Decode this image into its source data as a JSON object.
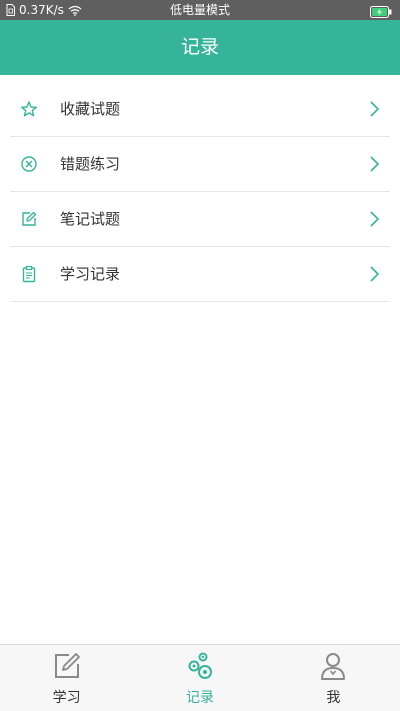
{
  "status_bar": {
    "network_speed": "0.37K/s",
    "center_text": "低电量模式",
    "icons": [
      "sim-icon",
      "wifi-icon",
      "battery-charging-icon"
    ]
  },
  "header": {
    "title": "记录"
  },
  "menu": {
    "items": [
      {
        "label": "收藏试题",
        "icon": "star-icon"
      },
      {
        "label": "错题练习",
        "icon": "circle-x-icon"
      },
      {
        "label": "笔记试题",
        "icon": "edit-note-icon"
      },
      {
        "label": "学习记录",
        "icon": "clipboard-icon"
      }
    ]
  },
  "bottom_nav": {
    "tabs": [
      {
        "label": "学习",
        "icon": "pencil-square-icon",
        "active": false
      },
      {
        "label": "记录",
        "icon": "gears-icon",
        "active": true
      },
      {
        "label": "我",
        "icon": "person-icon",
        "active": false
      }
    ]
  },
  "colors": {
    "accent": "#35b49a",
    "status_bar_bg": "#5f5f5f",
    "text": "#333333",
    "divider": "#e6e6e6",
    "nav_bg": "#f7f7f7"
  }
}
